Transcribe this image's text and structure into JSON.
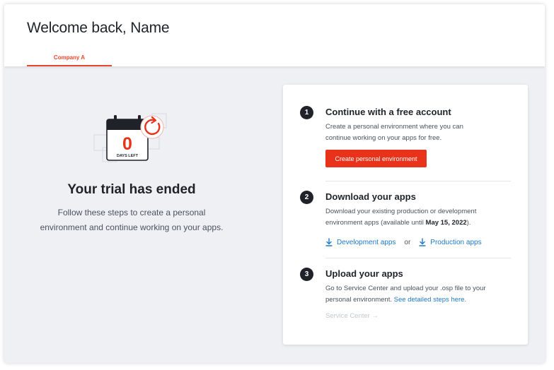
{
  "header": {
    "title": "Welcome back, Name",
    "tab_label": "Company A"
  },
  "trial": {
    "days_left_value": "0",
    "days_left_label": "DAYS LEFT",
    "title": "Your trial has ended",
    "description_line1": "Follow these steps to create a personal",
    "description_line2": "environment and continue working on your apps."
  },
  "steps": [
    {
      "number": "1",
      "title": "Continue with a free account",
      "text_line1": "Create a personal environment where you can",
      "text_line2": "continue working on your apps for free.",
      "button_label": "Create personal environment"
    },
    {
      "number": "2",
      "title": "Download your apps",
      "text_line1": "Download your existing production or development",
      "text_line2_prefix": "environment apps (available until ",
      "text_line2_date": "May 15, 2022",
      "text_line2_suffix": ").",
      "dev_link": "Development apps",
      "or_text": "or",
      "prod_link": "Production apps"
    },
    {
      "number": "3",
      "title": "Upload your apps",
      "text_line1": "Go to Service Center and upload your .osp file to your",
      "text_line2_prefix": "personal environment. ",
      "text_line2_link": "See detailed steps here.",
      "service_link": "Service Center →"
    }
  ],
  "colors": {
    "accent": "#e8321a",
    "link": "#1f78c8",
    "background": "#eef0f3"
  },
  "icons": [
    "calendar-icon",
    "refresh-icon",
    "download-icon"
  ]
}
